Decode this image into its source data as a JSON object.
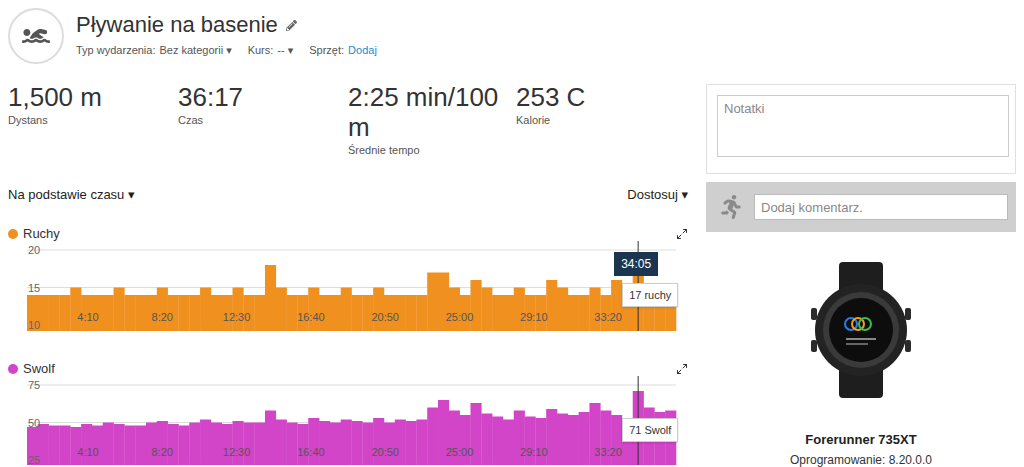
{
  "activity": {
    "title": "Pływanie na basenie",
    "meta": [
      {
        "label": "Typ wydarzenia:",
        "value": "Bez kategorii ▾",
        "link": false
      },
      {
        "label": "Kurs:",
        "value": "-- ▾",
        "link": false
      },
      {
        "label": "Sprzęt:",
        "value": "Dodaj",
        "link": true
      }
    ]
  },
  "stats": [
    {
      "value": "1,500 m",
      "label": "Dystans"
    },
    {
      "value": "36:17",
      "label": "Czas"
    },
    {
      "value": "2:25 min/100 m",
      "label": "Średnie tempo"
    },
    {
      "value": "253 C",
      "label": "Kalorie"
    }
  ],
  "controls": {
    "basis": "Na podstawie czasu ▾",
    "customize": "Dostosuj ▾"
  },
  "charts": [
    {
      "title": "Ruchy",
      "color": "#f0901e",
      "y_ticks": [
        "20",
        "15",
        "10"
      ],
      "y_min": 10,
      "y_max": 20,
      "x_ticks": [
        "4:10",
        "8:20",
        "12:30",
        "16:40",
        "20:50",
        "25:00",
        "29:10",
        "33:20"
      ],
      "values": [
        14,
        14,
        14,
        14,
        15,
        14,
        14,
        14,
        15,
        14,
        14,
        14,
        15,
        14,
        14,
        14,
        15,
        14,
        14,
        15,
        14,
        14,
        18,
        15,
        14,
        14,
        15,
        14,
        14,
        15,
        14,
        14,
        15,
        14,
        14,
        14,
        14,
        17,
        17,
        15,
        14,
        16,
        15,
        14,
        14,
        15,
        14,
        14,
        16,
        15,
        14,
        14,
        15,
        14,
        16,
        14,
        17,
        15,
        14,
        14
      ],
      "cursor": {
        "index": 56,
        "time": "34:05",
        "label": "17 ruchy"
      }
    },
    {
      "title": "Swolf",
      "color": "#d244c8",
      "y_ticks": [
        "75",
        "50",
        "25"
      ],
      "y_min": 25,
      "y_max": 75,
      "x_ticks": [
        "4:10",
        "8:20",
        "12:30",
        "16:40",
        "20:50",
        "25:00",
        "29:10",
        "33:20"
      ],
      "values": [
        47,
        49,
        48,
        48,
        47,
        49,
        48,
        50,
        49,
        48,
        48,
        50,
        51,
        49,
        48,
        50,
        52,
        50,
        49,
        51,
        50,
        50,
        58,
        52,
        50,
        49,
        53,
        51,
        50,
        52,
        51,
        50,
        53,
        50,
        52,
        51,
        52,
        60,
        65,
        58,
        55,
        63,
        56,
        54,
        52,
        58,
        54,
        53,
        59,
        56,
        55,
        57,
        63,
        58,
        55,
        52,
        71,
        60,
        57,
        58
      ],
      "cursor": {
        "index": 56,
        "label": "71 Swolf"
      }
    }
  ],
  "notes": {
    "placeholder": "Notatki"
  },
  "comment": {
    "placeholder": "Dodaj komentarz."
  },
  "device": {
    "name": "Forerunner 735XT",
    "software": "Oprogramowanie: 8.20.0.0"
  }
}
